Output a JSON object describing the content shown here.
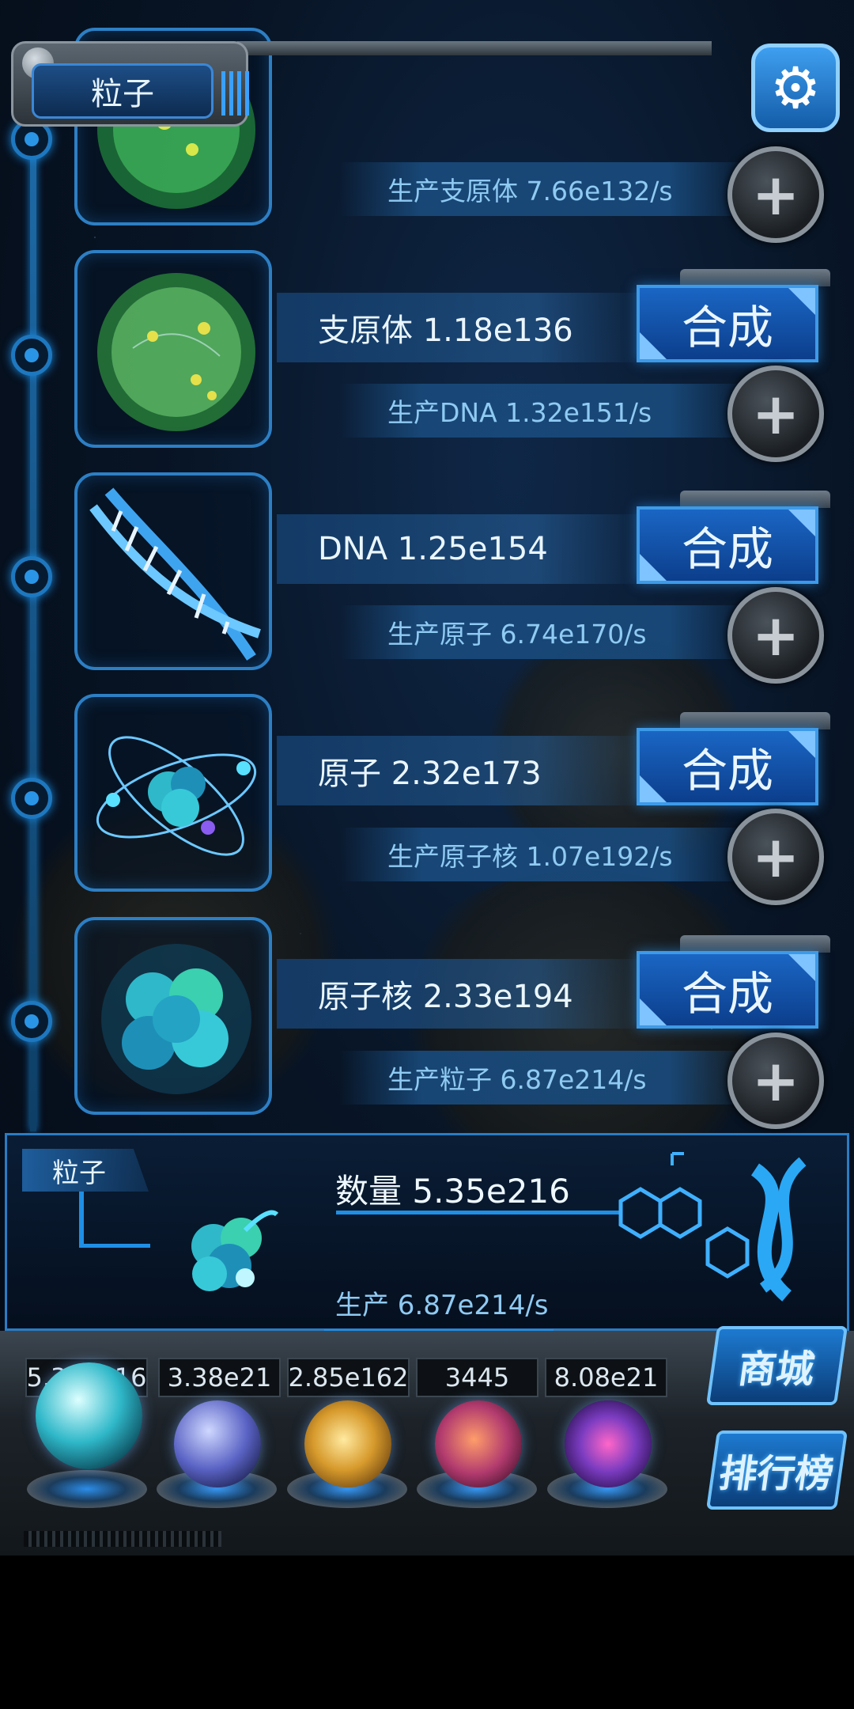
{
  "header": {
    "title": "粒子",
    "settings_icon": "gear-icon"
  },
  "rows": [
    {
      "name_label": "",
      "production_text": "生产支原体 7.66e132/s",
      "synth_label": "",
      "icon": "cell-icon"
    },
    {
      "name_label": "支原体 1.18e136",
      "production_text": "生产DNA 1.32e151/s",
      "synth_label": "合成",
      "icon": "mycoplasma-icon"
    },
    {
      "name_label": "DNA 1.25e154",
      "production_text": "生产原子 6.74e170/s",
      "synth_label": "合成",
      "icon": "dna-icon"
    },
    {
      "name_label": "原子 2.32e173",
      "production_text": "生产原子核 1.07e192/s",
      "synth_label": "合成",
      "icon": "atom-icon"
    },
    {
      "name_label": "原子核 2.33e194",
      "production_text": "生产粒子 6.87e214/s",
      "synth_label": "合成",
      "icon": "nucleus-icon"
    }
  ],
  "info_panel": {
    "label": "粒子",
    "count_text": "数量 5.35e216",
    "production_text": "生产 6.87e214/s",
    "icon": "particle-icon",
    "decoration": "dna-molecule-icon"
  },
  "resources": [
    {
      "value": "5.35e216",
      "icon": "particle-orb-icon",
      "color": "#2fb8c9"
    },
    {
      "value": "3.38e21",
      "icon": "lightning-orb-icon",
      "color": "#5a63c4"
    },
    {
      "value": "2.85e162",
      "icon": "galaxy-orb-icon",
      "color": "#d79a2c"
    },
    {
      "value": "3445",
      "icon": "brain-orb-icon",
      "color": "#b23b6e"
    },
    {
      "value": "8.08e21",
      "icon": "vortex-orb-icon",
      "color": "#7b3cc0"
    }
  ],
  "side_buttons": {
    "shop_label": "商城",
    "ranking_label": "排行榜"
  },
  "colors": {
    "accent": "#2a8fe6",
    "synth_button": "#1a66c4",
    "background": "#081526"
  }
}
